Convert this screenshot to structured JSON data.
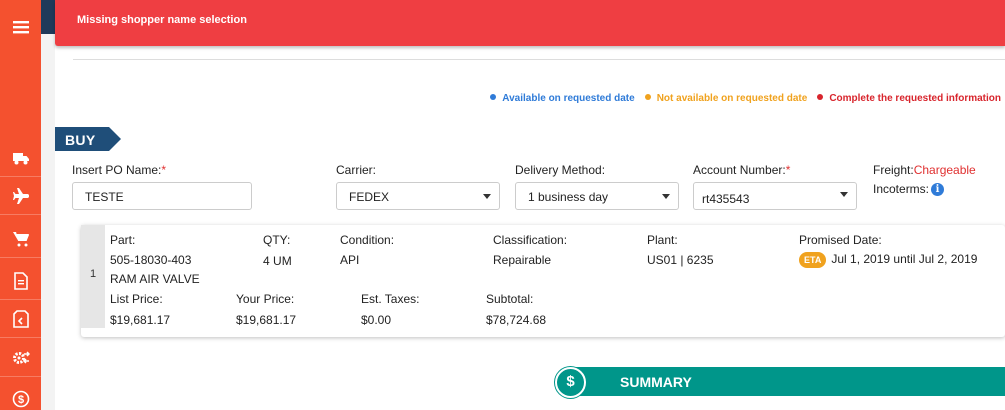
{
  "sidebar": {
    "items": [
      {
        "icon": "truck-icon"
      },
      {
        "icon": "airplane-icon"
      },
      {
        "icon": "cart-icon"
      },
      {
        "icon": "document-icon"
      },
      {
        "icon": "return-box-icon"
      },
      {
        "icon": "gear-exchange-icon"
      },
      {
        "icon": "dollar-icon"
      }
    ]
  },
  "alert": {
    "message": "Missing shopper name selection"
  },
  "legend": {
    "available": "Available on requested date",
    "not_available": "Not available on requested date",
    "complete": "Complete the requested information"
  },
  "section": {
    "buy_label": "BUY"
  },
  "form": {
    "po_label": "Insert PO Name:",
    "po_value": "TESTE",
    "carrier_label": "Carrier:",
    "carrier_value": "FEDEX",
    "delivery_label": "Delivery Method:",
    "delivery_value": "1 business day",
    "account_label": "Account Number:",
    "account_value": "rt435543",
    "freight_label": "Freight:",
    "freight_value": "Chargeable",
    "incoterms_label": "Incoterms:",
    "required_mark": "*",
    "info_glyph": "i"
  },
  "item": {
    "number": "1",
    "part_label": "Part:",
    "part_number": "505-18030-403",
    "part_name": "RAM AIR VALVE",
    "qty_label": "QTY:",
    "qty_value": "4",
    "qty_unit": "UM",
    "condition_label": "Condition:",
    "condition_value": "API",
    "classification_label": "Classification:",
    "classification_value": "Repairable",
    "plant_label": "Plant:",
    "plant_value": "US01 | 6235",
    "promised_label": "Promised Date:",
    "eta_badge": "ETA",
    "promised_value": "Jul 1, 2019 until Jul 2, 2019",
    "list_price_label": "List Price:",
    "list_price_value": "$19,681.17",
    "your_price_label": "Your Price:",
    "your_price_value": "$19,681.17",
    "taxes_label": "Est. Taxes:",
    "taxes_value": "$0.00",
    "subtotal_label": "Subtotal:",
    "subtotal_value": "$78,724.68"
  },
  "summary": {
    "label": "SUMMARY",
    "icon_glyph": "$"
  },
  "colors": {
    "sidebar": "#f4512f",
    "alert": "#ef3e42",
    "buy_tag": "#1f4e79",
    "summary": "#00968a",
    "eta": "#f0a21e"
  }
}
